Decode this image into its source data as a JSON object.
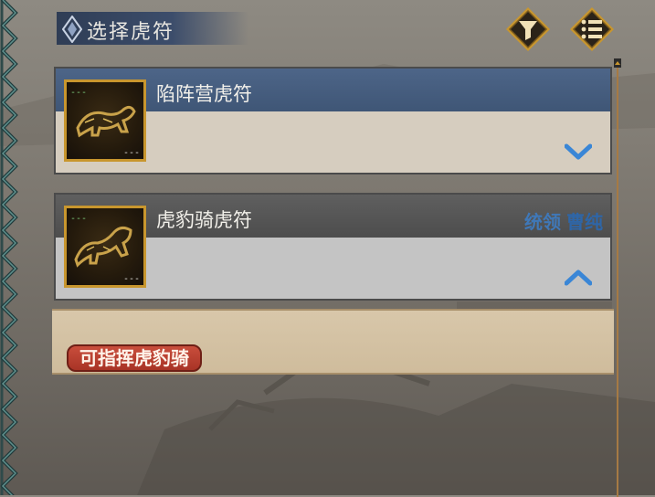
{
  "title": "选择虎符",
  "toolbar": {
    "filter_icon": "funnel-icon",
    "list_icon": "list-icon"
  },
  "cards": [
    {
      "name": "陷阵营虎符",
      "thumb_corner_tl": "---",
      "thumb_corner_br": "---",
      "expanded": false,
      "chevron": "chevron-down-icon"
    },
    {
      "name": "虎豹骑虎符",
      "thumb_corner_tl": "---",
      "thumb_corner_br": "---",
      "expanded": true,
      "chevron": "chevron-up-icon",
      "commander_label": "统领",
      "commander_name": "曹纯"
    }
  ],
  "detail": {
    "tag": "可指挥虎豹骑"
  },
  "colors": {
    "selected_header": "#4d6588",
    "unselected_header": "#5f5f5f",
    "thumb_border": "#c8962e",
    "chevron_blue": "#3a86d6",
    "commander_blue": "#3f78b8",
    "tag_red": "#c94e3c"
  }
}
